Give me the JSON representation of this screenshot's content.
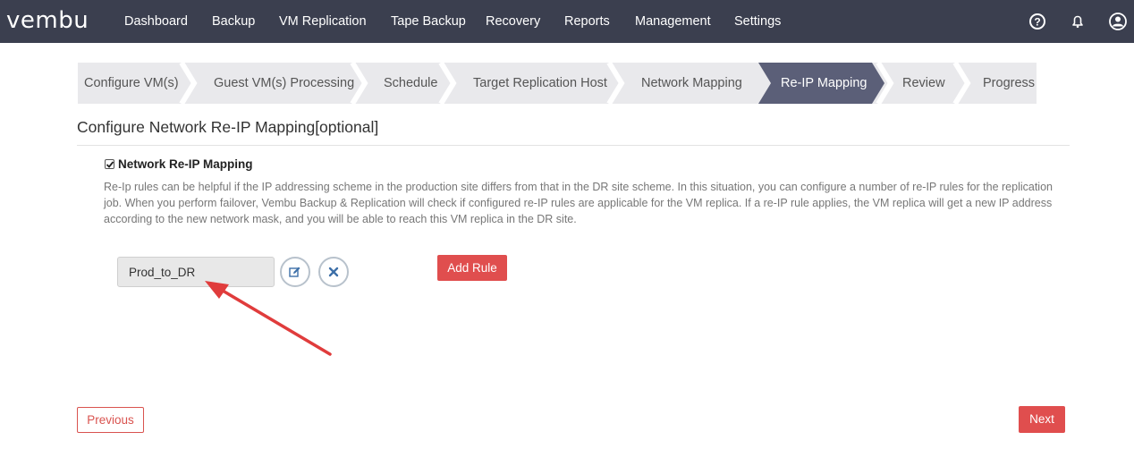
{
  "app": {
    "logo_text": "vembu"
  },
  "nav": {
    "items": [
      {
        "label": "Dashboard"
      },
      {
        "label": "Backup"
      },
      {
        "label": "VM Replication"
      },
      {
        "label": "Tape Backup"
      },
      {
        "label": "Recovery"
      },
      {
        "label": "Reports"
      },
      {
        "label": "Management"
      },
      {
        "label": "Settings"
      }
    ],
    "icons": [
      "help-icon",
      "bell-icon",
      "user-icon"
    ]
  },
  "wizard": {
    "steps": [
      {
        "label": "Configure VM(s)"
      },
      {
        "label": "Guest VM(s) Processing"
      },
      {
        "label": "Schedule"
      },
      {
        "label": "Target Replication Host"
      },
      {
        "label": "Network Mapping"
      },
      {
        "label": "Re-IP Mapping"
      },
      {
        "label": "Review"
      },
      {
        "label": "Progress"
      }
    ],
    "active_index": 5
  },
  "content": {
    "title": "Configure Network Re-IP Mapping[optional]",
    "checkbox_label": "Network Re-IP Mapping",
    "checkbox_checked": true,
    "description": "Re-Ip rules can be helpful if the IP addressing scheme in the production site differs from that in the DR site scheme. In this situation, you can configure a number of re-IP rules for the replication job. When you perform failover, Vembu Backup & Replication will check if configured re-IP rules are applicable for the VM replica. If a re-IP rule applies, the VM replica will get a new IP address according to the new network mask, and you will be able to reach this VM replica in the DR site.",
    "rules": [
      {
        "name": "Prod_to_DR"
      }
    ],
    "add_rule_label": "Add Rule"
  },
  "footer": {
    "previous_label": "Previous",
    "next_label": "Next"
  },
  "colors": {
    "navbar": "#3b3f4f",
    "active_step": "#5b5f78",
    "accent_red": "#e04e4e",
    "annotation_arrow": "#e03c3c"
  }
}
